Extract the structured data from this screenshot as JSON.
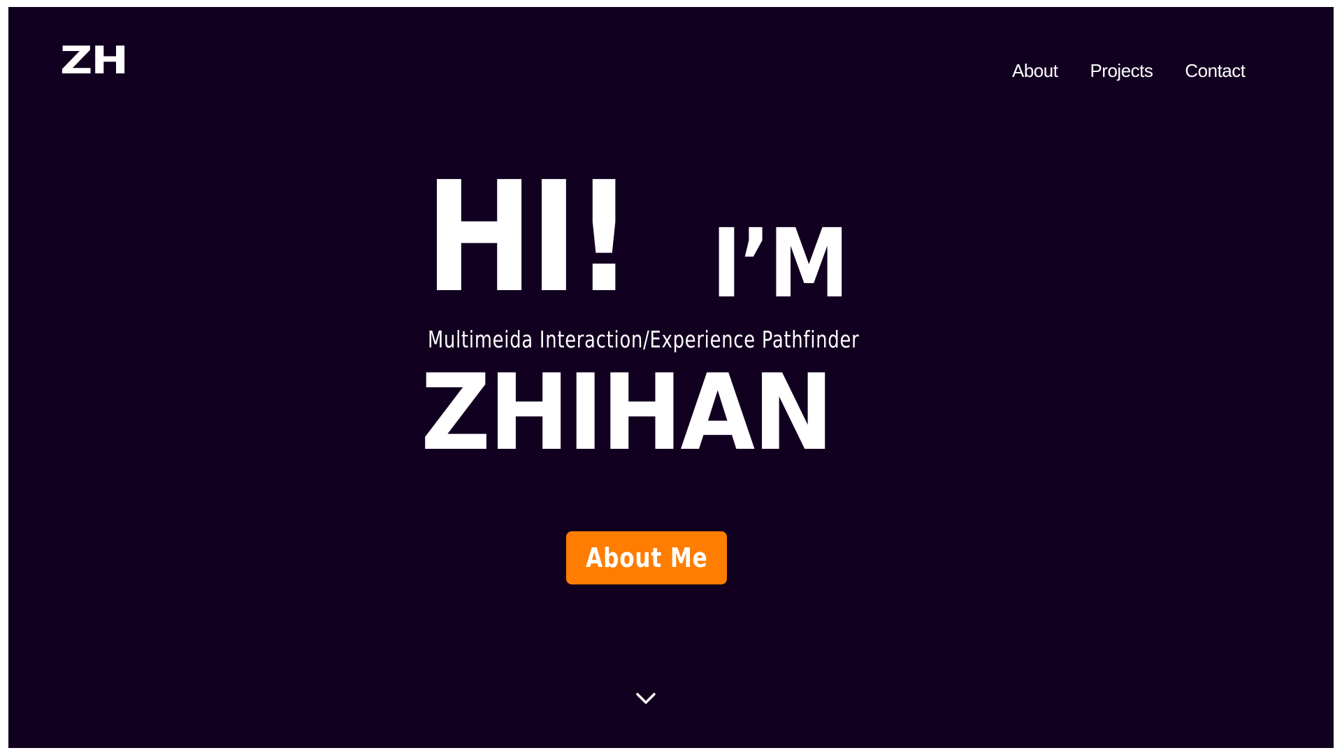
{
  "brand": {
    "logo_text": "ZH"
  },
  "nav": {
    "items": [
      {
        "label": "About"
      },
      {
        "label": "Projects"
      },
      {
        "label": "Contact"
      }
    ]
  },
  "hero": {
    "greeting": "HI!",
    "im": "I’M",
    "subtitle": "Multimeida Interaction/Experience Pathfinder",
    "name": "ZHIHAN",
    "cta_label": "About Me",
    "scroll_icon": "chevron-down-icon"
  },
  "colors": {
    "background": "#120020",
    "accent": "#ff7d00",
    "text": "#ffffff"
  }
}
